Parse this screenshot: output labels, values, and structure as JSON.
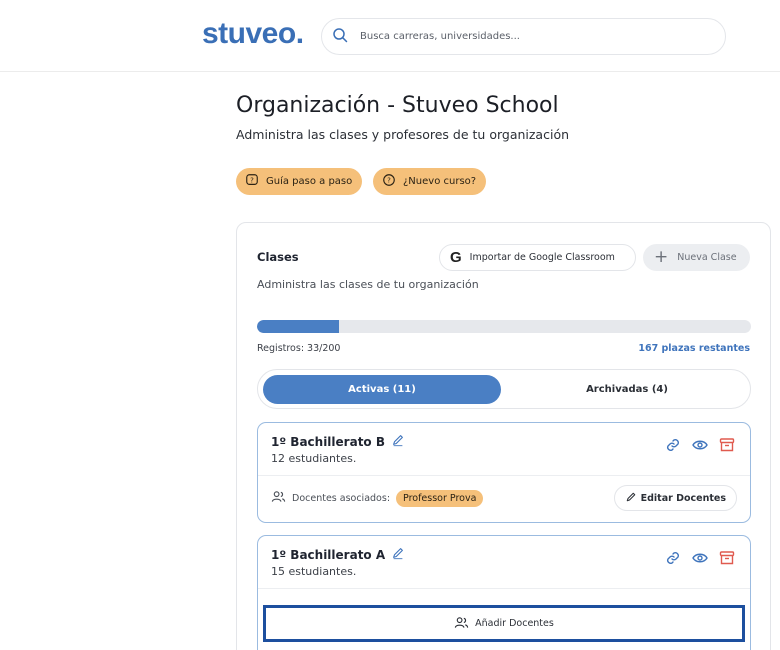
{
  "header": {
    "logo_text": "stuveo.",
    "search_placeholder": "Busca carreras, universidades..."
  },
  "page": {
    "title": "Organización - Stuveo School",
    "subtitle": "Administra las clases y profesores de tu organización"
  },
  "help_buttons": {
    "guide_label": "Guía paso a paso",
    "new_course_label": "¿Nuevo curso?"
  },
  "classes_card": {
    "title": "Clases",
    "description": "Administra las clases de tu organización",
    "import_label": "Importar de Google Classroom",
    "new_class_label": "Nueva Clase",
    "registrations_text": "Registros: 33/200",
    "registrations_used": 33,
    "registrations_total": 200,
    "remaining_text": "167 plazas restantes",
    "tabs": [
      {
        "label": "Activas (11)",
        "active": true
      },
      {
        "label": "Archivadas (4)",
        "active": false
      }
    ],
    "classes": [
      {
        "name": "1º Bachillerato B",
        "students": "12 estudiantes.",
        "teachers_label": "Docentes asociados:",
        "teachers": [
          "Professor Prova"
        ],
        "edit_label": "Editar Docentes"
      },
      {
        "name": "1º Bachillerato A",
        "students": "15 estudiantes.",
        "add_teachers_label": "Añadir Docentes"
      }
    ]
  },
  "colors": {
    "brand": "#3a6fb6",
    "accent": "#4a7fc4",
    "pill": "#f5c07a",
    "archive": "#e05a4f"
  }
}
